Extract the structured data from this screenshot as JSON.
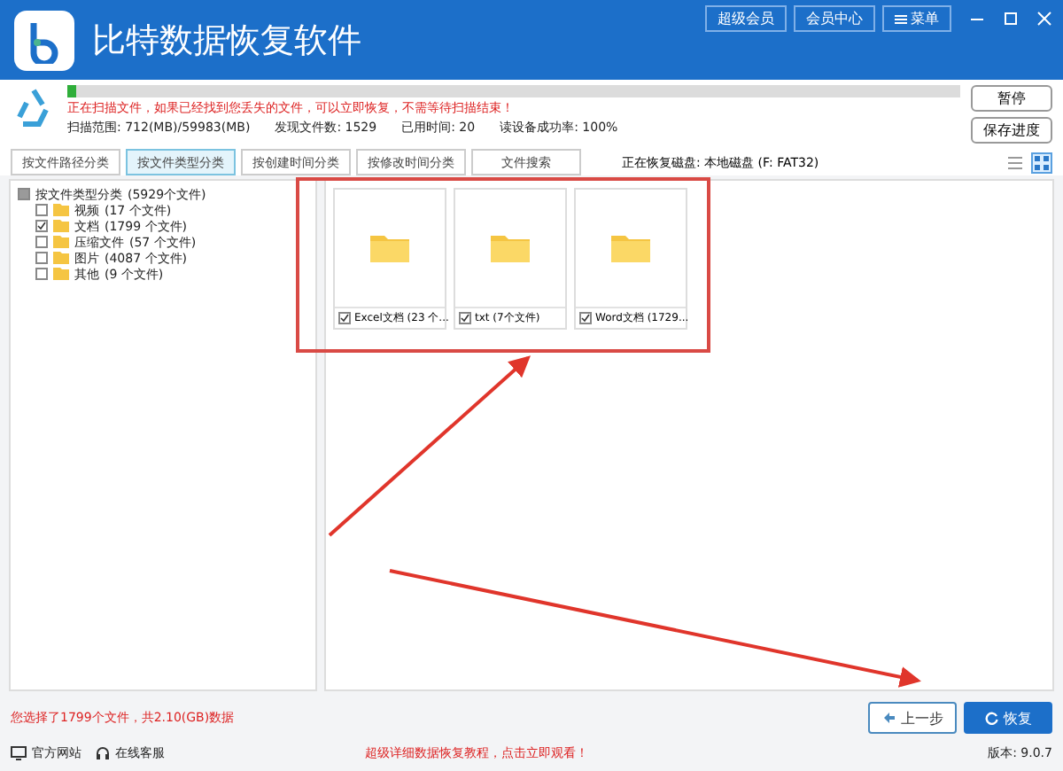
{
  "window": {
    "title": "比特数据恢复软件",
    "header_buttons": [
      "超级会员",
      "会员中心",
      "菜单"
    ]
  },
  "scan": {
    "level": 0.01,
    "message": "正在扫描文件，如果已经找到您丢失的文件，可以立即恢复，不需等待扫描结束！",
    "stats": [
      "扫描范围: 712(MB)/59983(MB)",
      "发现文件数: 1529",
      "已用时间: 20",
      "读设备成功率: 100%"
    ],
    "buttons": [
      "暂停",
      "保存进度"
    ]
  },
  "tabs": [
    {
      "label": "按文件路径分类",
      "selected": false
    },
    {
      "label": "按文件类型分类",
      "selected": true
    },
    {
      "label": "按创建时间分类",
      "selected": false
    },
    {
      "label": "按修改时间分类",
      "selected": false
    },
    {
      "label": "文件搜索",
      "selected": false
    }
  ],
  "disk_info": "正在恢复磁盘: 本地磁盘 (F: FAT32)",
  "view_modes": [
    {
      "selected": false
    },
    {
      "selected": true
    }
  ],
  "tree": {
    "label": "按文件类型分类",
    "count": "(5929个文件)",
    "checked": false,
    "partial": true,
    "children": [
      {
        "label": "视频",
        "count": "(17 个文件)",
        "checked": false
      },
      {
        "label": "文档",
        "count": "(1799 个文件)",
        "checked": true
      },
      {
        "label": "压缩文件",
        "count": "(57 个文件)",
        "checked": false
      },
      {
        "label": "图片",
        "count": "(4087 个文件)",
        "checked": false
      },
      {
        "label": "其他",
        "count": "(9 个文件)",
        "checked": false
      }
    ]
  },
  "folders": [
    {
      "label": "Excel文档 (23 个...",
      "checked": true
    },
    {
      "label": "txt (7个文件)",
      "checked": true
    },
    {
      "label": "Word文档 (1729...",
      "checked": true
    }
  ],
  "selection_summary": "您选择了1799个文件，共2.10(GB)数据",
  "actions": [
    {
      "label": "上一步",
      "kind": "back"
    },
    {
      "label": "恢复",
      "kind": "primary"
    }
  ],
  "footer": {
    "links": [
      {
        "label": "官方网站",
        "kind": "site"
      },
      {
        "label": "在线客服",
        "kind": "support"
      }
    ],
    "promo": "超级详细数据恢复教程，点击立即观看！",
    "version": "版本: 9.0.7"
  }
}
